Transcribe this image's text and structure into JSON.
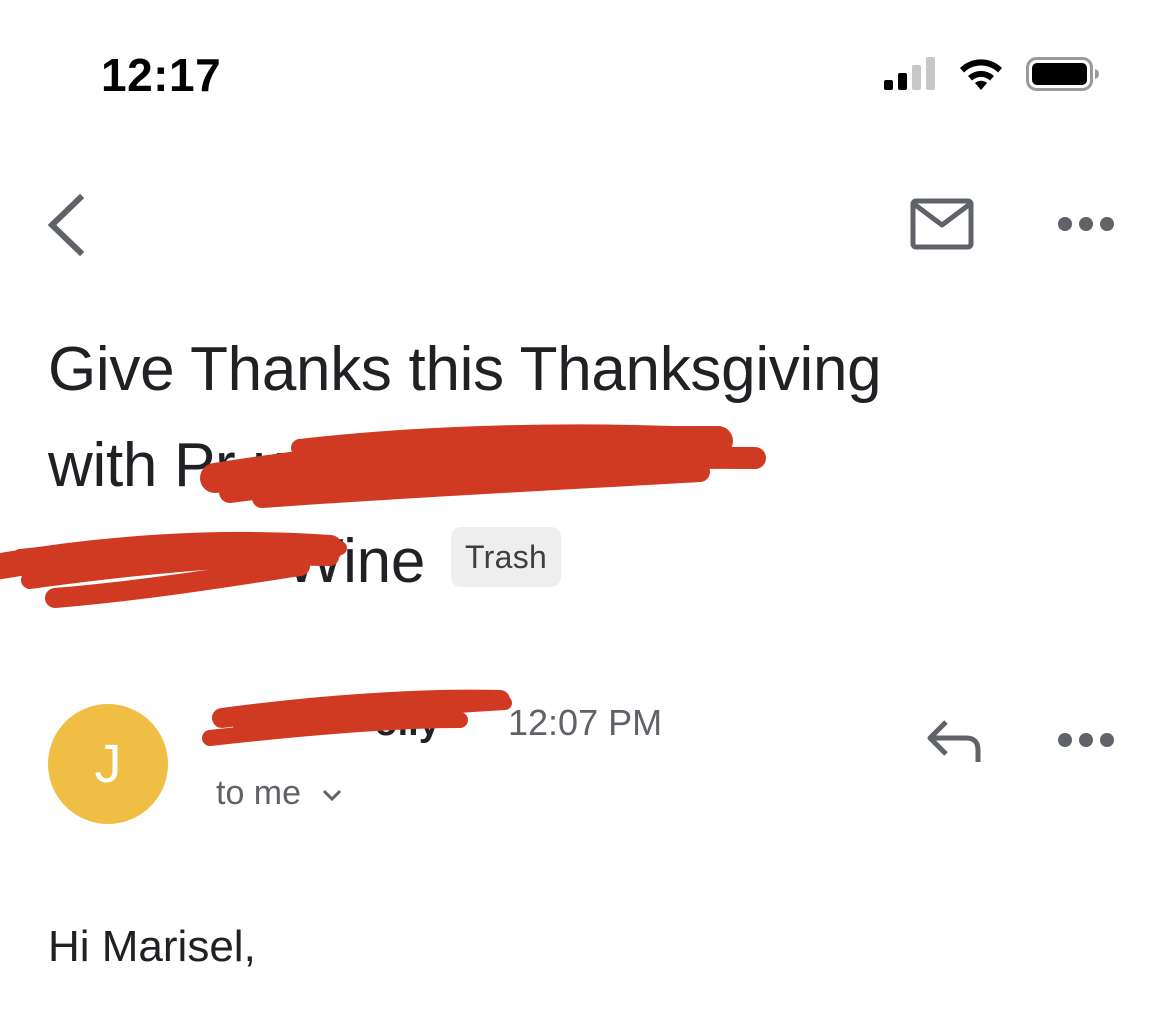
{
  "status_bar": {
    "time": "12:17",
    "icons": [
      "cellular-signal-icon",
      "wifi-icon",
      "battery-icon"
    ]
  },
  "toolbar": {
    "back_icon": "chevron-left-icon",
    "mark_unread_icon": "envelope-icon",
    "more_icon": "more-horizontal-icon"
  },
  "email": {
    "subject_lines": [
      "Give Thanks this Thanksgiving",
      "with Pr          ustralian",
      "              Wine"
    ],
    "label_badge": "Trash",
    "sender": {
      "avatar_initial": "J",
      "name": "               olly",
      "time": "12:07 PM",
      "recipient": "to me"
    },
    "body_greeting": "Hi Marisel,"
  },
  "colors": {
    "avatar": "#f0bd45",
    "badge_bg": "#eeeeee",
    "text_primary": "#202124",
    "text_secondary": "#5f6368",
    "icon": "#5f6368",
    "redaction": "#d03a22"
  }
}
